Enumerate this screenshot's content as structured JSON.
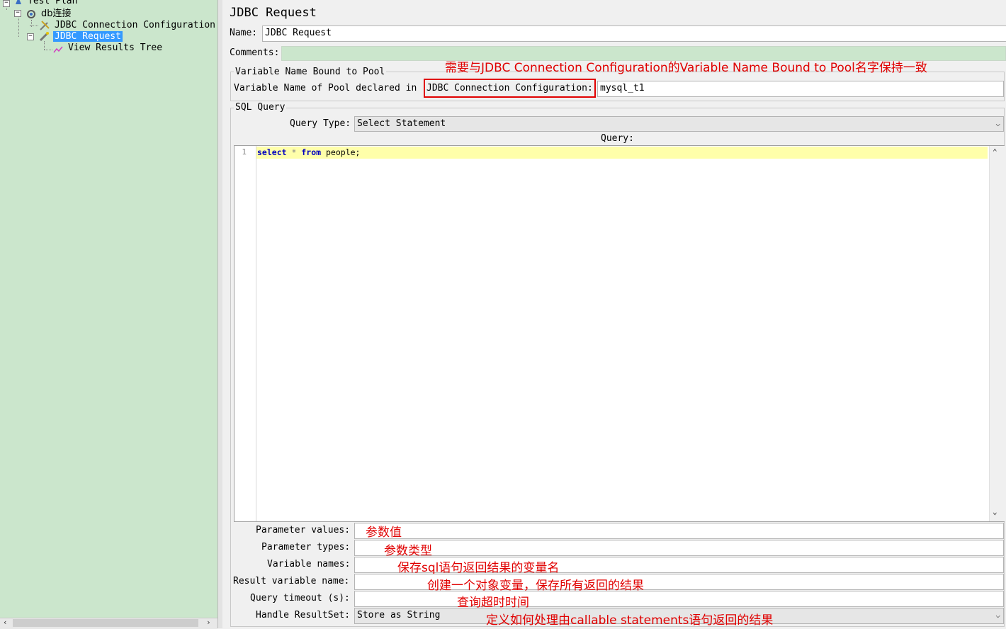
{
  "tree": {
    "test_plan": "Test Plan",
    "thread_group": "db连接",
    "jdbc_connection": "JDBC Connection Configuration",
    "jdbc_request": "JDBC Request",
    "view_results": "View Results Tree"
  },
  "panel": {
    "title": "JDBC Request",
    "name_label": "Name:",
    "name_value": "JDBC Request",
    "comments_label": "Comments:"
  },
  "pool": {
    "legend": "Variable Name Bound to Pool",
    "label_prefix": "Variable Name of Pool declared in",
    "label_highlight": "JDBC Connection Configuration:",
    "value": "mysql_t1"
  },
  "sql": {
    "legend": "SQL Query",
    "query_type_label": "Query Type:",
    "query_type_value": "Select Statement",
    "query_label": "Query:",
    "line_number": "1",
    "code": {
      "kw_select": "select",
      "star": "*",
      "kw_from": "from",
      "rest": "people;"
    }
  },
  "params": {
    "parameter_values_label": "Parameter values:",
    "parameter_types_label": "Parameter types:",
    "variable_names_label": "Variable names:",
    "result_variable_name_label": "Result variable name:",
    "query_timeout_label": "Query timeout (s):",
    "handle_resultset_label": "Handle ResultSet:",
    "handle_resultset_value": "Store as String"
  },
  "annotations": {
    "pool_note": "需要与JDBC Connection Configuration的Variable Name Bound to Pool名字保持一致",
    "param_values": "参数值",
    "param_types": "参数类型",
    "variable_names": "保存sql语句返回结果的变量名",
    "result_variable": "创建一个对象变量，保存所有返回的结果",
    "query_timeout": "查询超时时间",
    "handle_resultset": "定义如何处理由callable statements语句返回的结果"
  },
  "colors": {
    "tree_bg": "#cbe6cc",
    "selection": "#3399ff",
    "annotation_red": "#e00000",
    "current_line": "#ffffaa"
  },
  "icons": {
    "scroll_left": "‹",
    "scroll_right": "›",
    "dropdown": "⌵",
    "scroll_up": "⌃",
    "scroll_down": "⌄"
  }
}
